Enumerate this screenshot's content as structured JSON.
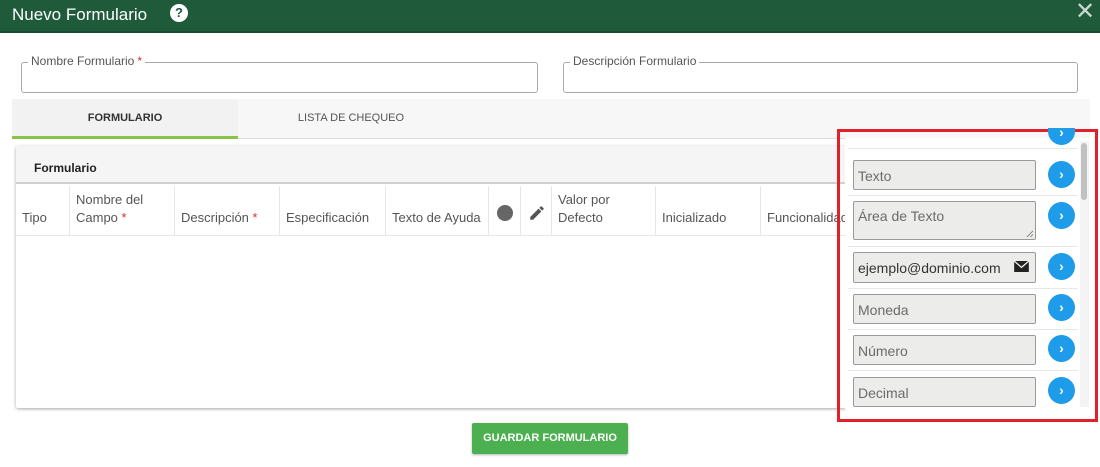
{
  "header": {
    "title": "Nuevo Formulario",
    "help_glyph": "?",
    "close_glyph": "✕",
    "background_color": "#1f5a3b"
  },
  "fields": {
    "nombre": {
      "label": "Nombre Formulario",
      "required_mark": "*",
      "value": ""
    },
    "descripcion": {
      "label": "Descripción Formulario",
      "value": ""
    }
  },
  "tabs": [
    {
      "label": "FORMULARIO",
      "active": true
    },
    {
      "label": "LISTA DE CHEQUEO",
      "active": false
    }
  ],
  "card": {
    "title": "Formulario",
    "columns": [
      {
        "label": "Tipo"
      },
      {
        "label_line1": "Nombre del",
        "label_line2": "Campo",
        "required_mark": "*"
      },
      {
        "label": "Descripción",
        "required_mark": "*"
      },
      {
        "label": "Especificación"
      },
      {
        "label": "Texto de Ayuda"
      },
      {
        "icon": "dot-icon"
      },
      {
        "icon": "pencil-icon"
      },
      {
        "label_line1": "Valor por",
        "label_line2": "Defecto"
      },
      {
        "label": "Inicializado"
      },
      {
        "label": "Funcionalidad"
      }
    ]
  },
  "palette": {
    "items": [
      {
        "placeholder": "Texto",
        "type": "text"
      },
      {
        "placeholder": "Área de Texto",
        "type": "textarea"
      },
      {
        "value": "ejemplo@dominio.com",
        "type": "email",
        "icon": "envelope-icon"
      },
      {
        "placeholder": "Moneda",
        "type": "currency"
      },
      {
        "placeholder": "Número",
        "type": "number"
      },
      {
        "placeholder": "Decimal",
        "type": "decimal"
      }
    ],
    "add_glyph": "›",
    "accent_color": "#1e9be9",
    "highlight_color": "#e0212c"
  },
  "actions": {
    "save_label": "GUARDAR FORMULARIO",
    "save_color": "#4caf50"
  }
}
